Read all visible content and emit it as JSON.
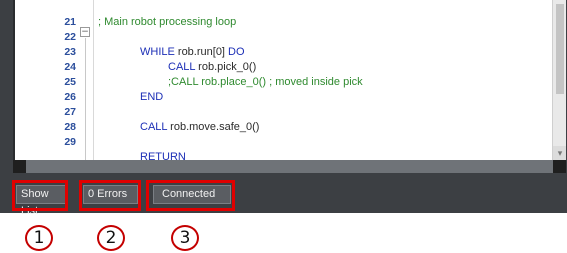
{
  "editor": {
    "lines": [
      {
        "num": "21",
        "parts": [
          {
            "t": "; Main robot processing loop",
            "c": "cm"
          }
        ],
        "indent": 0
      },
      {
        "num": "22",
        "parts": [],
        "indent": 0
      },
      {
        "num": "23",
        "parts": [
          {
            "t": "WHILE ",
            "c": "kw"
          },
          {
            "t": "rob.run[0]",
            "c": "id"
          },
          {
            "t": " DO",
            "c": "kw"
          }
        ],
        "indent": 1
      },
      {
        "num": "24",
        "parts": [
          {
            "t": "CALL ",
            "c": "kw"
          },
          {
            "t": "rob.pick_0()",
            "c": "id"
          }
        ],
        "indent": 2
      },
      {
        "num": "25",
        "parts": [
          {
            "t": ";CALL rob.place_0() ; moved inside pick",
            "c": "cm"
          }
        ],
        "indent": 2
      },
      {
        "num": "26",
        "parts": [
          {
            "t": "END",
            "c": "kw"
          }
        ],
        "indent": 1
      },
      {
        "num": "27",
        "parts": [],
        "indent": 0
      },
      {
        "num": "28",
        "parts": [
          {
            "t": "CALL ",
            "c": "kw"
          },
          {
            "t": "rob.move.safe_0()",
            "c": "id"
          }
        ],
        "indent": 1
      },
      {
        "num": "29",
        "parts": [],
        "indent": 0
      }
    ],
    "partial_line": "RETURN",
    "fold_symbol": "−"
  },
  "statusbar": {
    "show_list_label": "Show List",
    "errors_label": "0 Errors",
    "connection_label": "Connected"
  },
  "callouts": [
    "1",
    "2",
    "3"
  ],
  "colors": {
    "highlight": "#e00000",
    "keyword": "#1c2fb6",
    "comment": "#2f8a2f",
    "line_number": "#2b4e9c"
  }
}
